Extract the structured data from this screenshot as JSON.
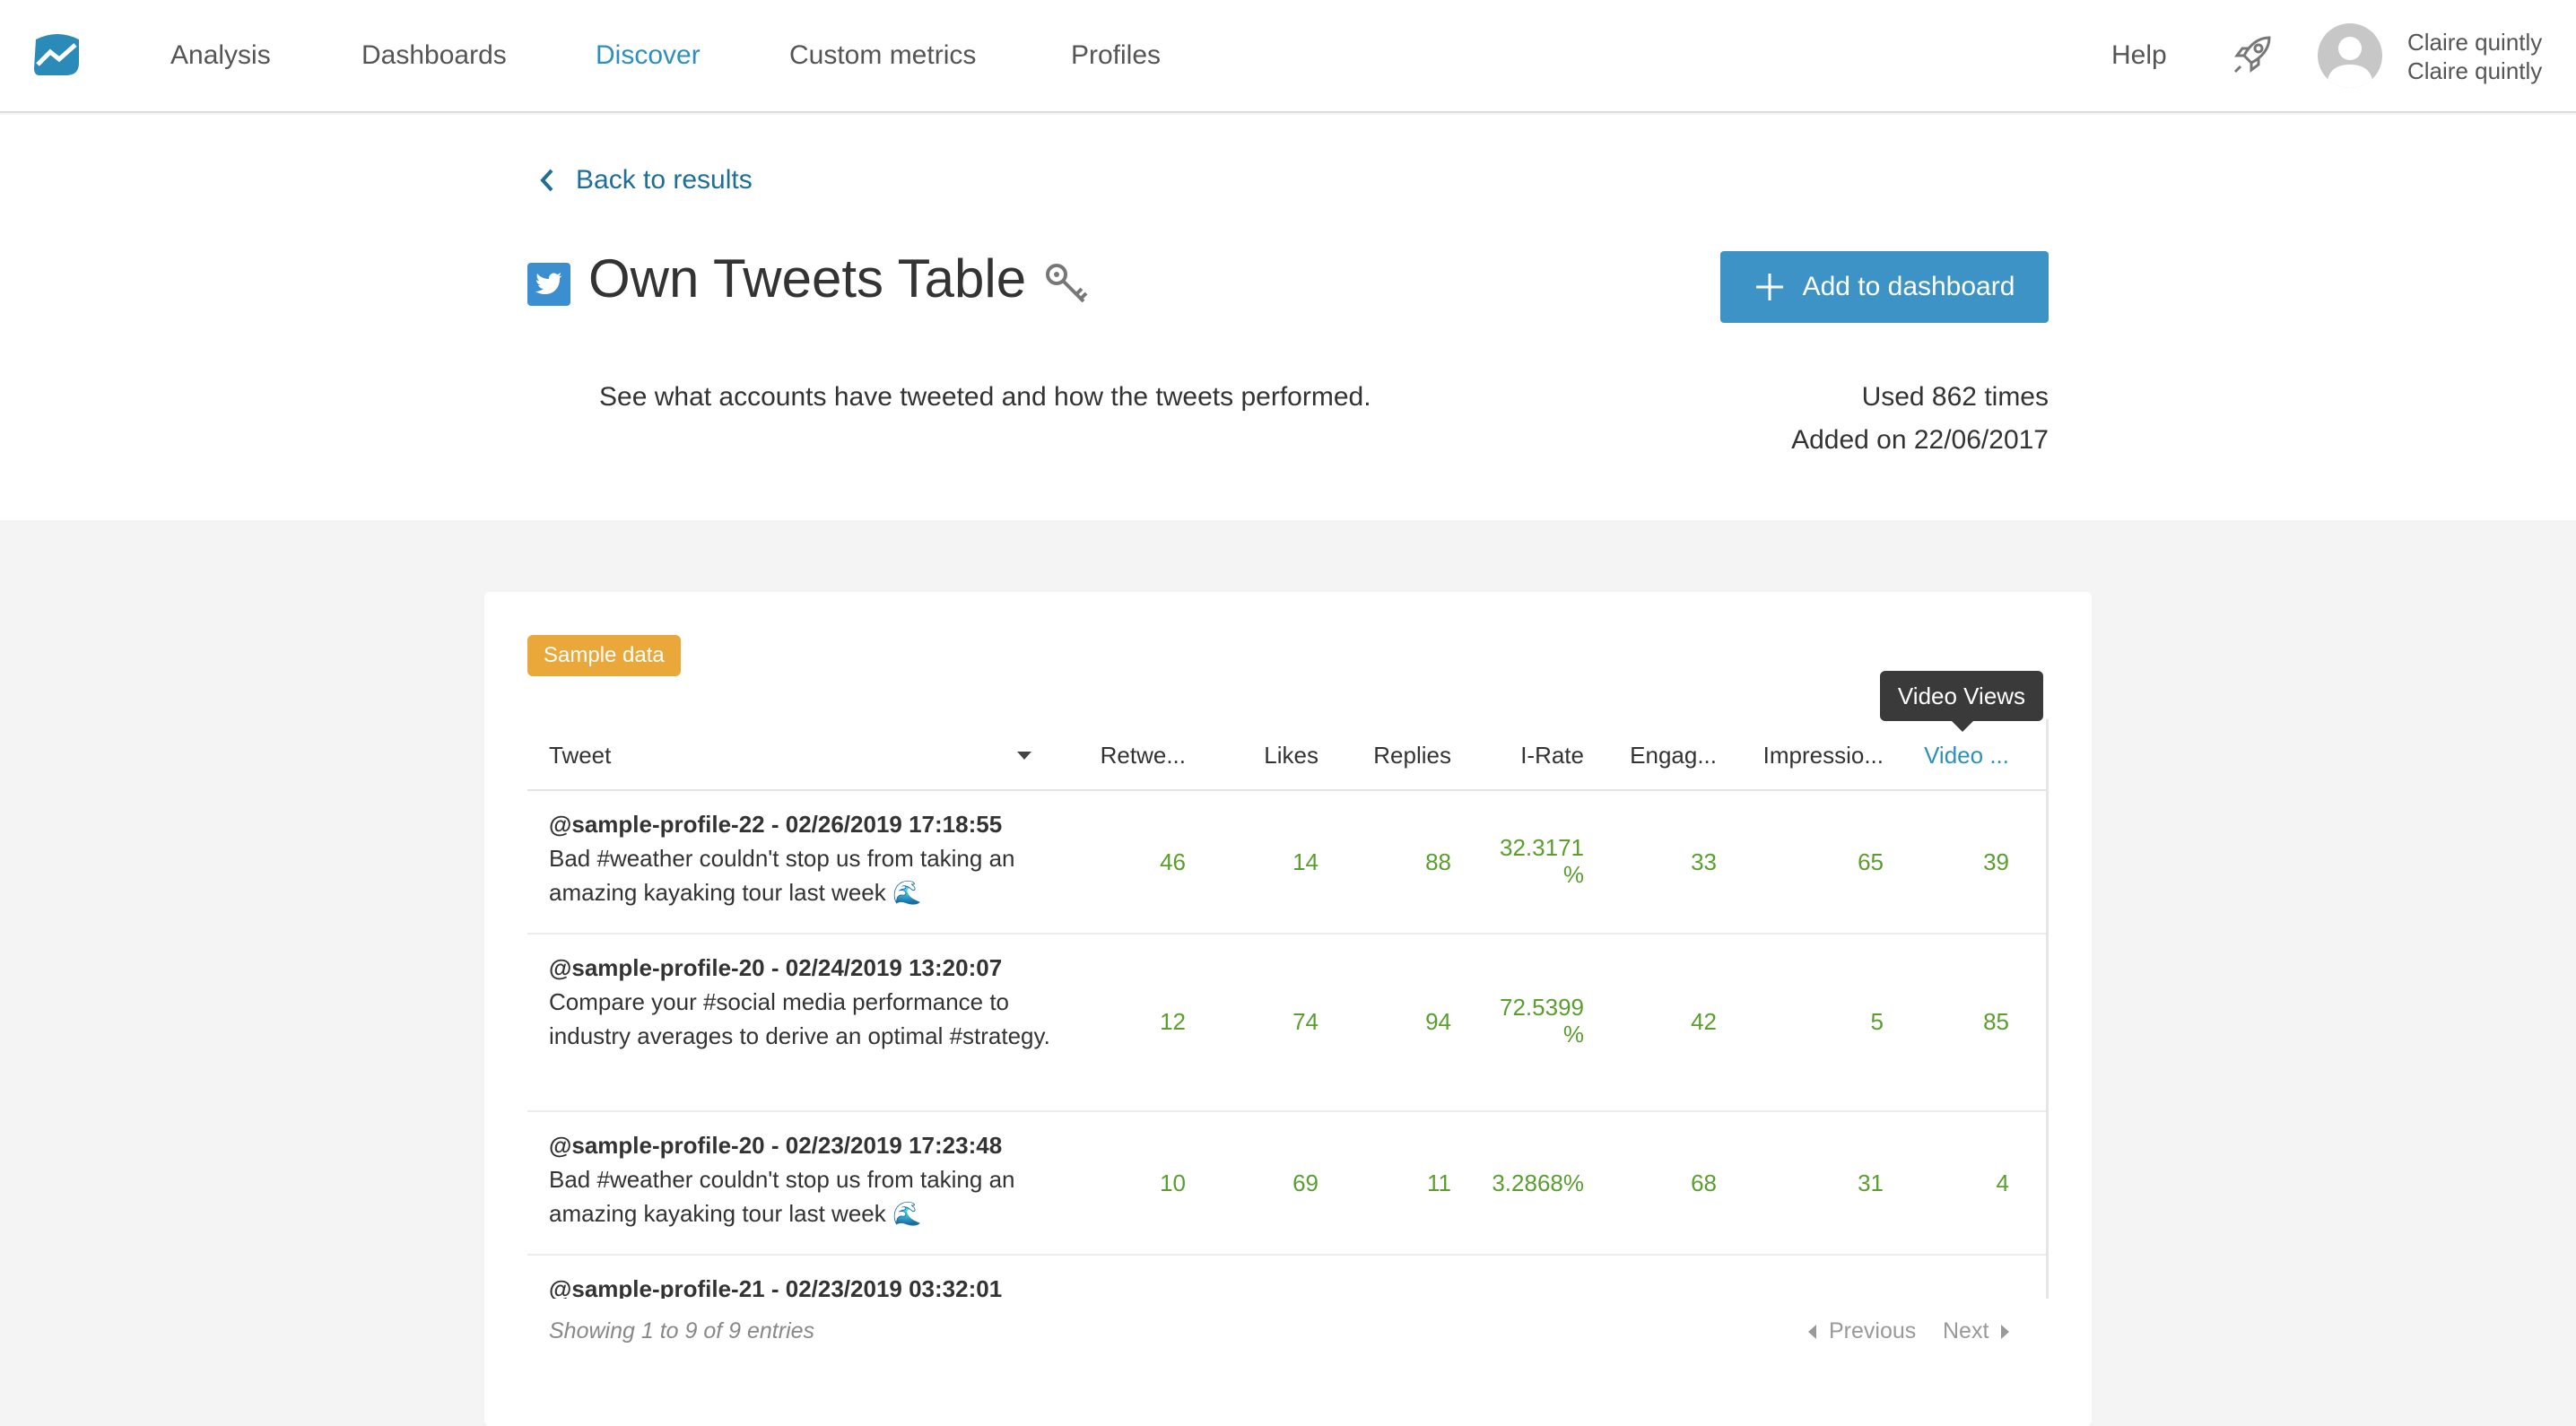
{
  "nav": {
    "items": [
      {
        "label": "Analysis"
      },
      {
        "label": "Dashboards"
      },
      {
        "label": "Discover"
      },
      {
        "label": "Custom metrics"
      },
      {
        "label": "Profiles"
      }
    ],
    "active": "Discover",
    "help": "Help",
    "user": {
      "name": "Claire quintly",
      "subtitle": "Claire quintly"
    }
  },
  "header": {
    "back": "Back to results",
    "title": "Own Tweets Table",
    "add_button": "Add to dashboard",
    "description": "See what accounts have tweeted and how the tweets performed.",
    "used": "Used 862 times",
    "added": "Added on 22/06/2017"
  },
  "card": {
    "badge": "Sample data",
    "tooltip": "Video Views",
    "columns": [
      "Tweet",
      "Retwe...",
      "Likes",
      "Replies",
      "I-Rate",
      "Engag...",
      "Impressio...",
      "Video ..."
    ],
    "rows": [
      {
        "head": "@sample-profile-22 - 02/26/2019 17:18:55",
        "text": "Bad #weather couldn't stop us from taking an amazing kayaking tour last week 🌊",
        "retweets": "46",
        "likes": "14",
        "replies": "88",
        "irate_a": "32.3171",
        "irate_b": "%",
        "engagement": "33",
        "impressions": "65",
        "video": "39"
      },
      {
        "head": "@sample-profile-20 - 02/24/2019 13:20:07",
        "text": "Compare your #social media performance to industry averages to derive an optimal #strategy.",
        "retweets": "12",
        "likes": "74",
        "replies": "94",
        "irate_a": "72.5399",
        "irate_b": "%",
        "engagement": "42",
        "impressions": "5",
        "video": "85"
      },
      {
        "head": "@sample-profile-20 - 02/23/2019 17:23:48",
        "text": "Bad #weather couldn't stop us from taking an amazing kayaking tour last week 🌊",
        "retweets": "10",
        "likes": "69",
        "replies": "11",
        "irate_a": "3.2868%",
        "irate_b": "",
        "engagement": "68",
        "impressions": "31",
        "video": "4"
      },
      {
        "head": "@sample-profile-21 - 02/23/2019 03:32:01",
        "text": "",
        "retweets": "",
        "likes": "",
        "replies": "",
        "irate_a": "",
        "irate_b": "",
        "engagement": "",
        "impressions": "",
        "video": ""
      }
    ],
    "footer": "Showing 1 to 9 of 9 entries",
    "previous": "Previous",
    "next": "Next"
  },
  "colors": {
    "accent": "#2d8fbe",
    "button": "#3d93c5",
    "badge": "#eba83a",
    "value_green": "#5a9e2f"
  }
}
